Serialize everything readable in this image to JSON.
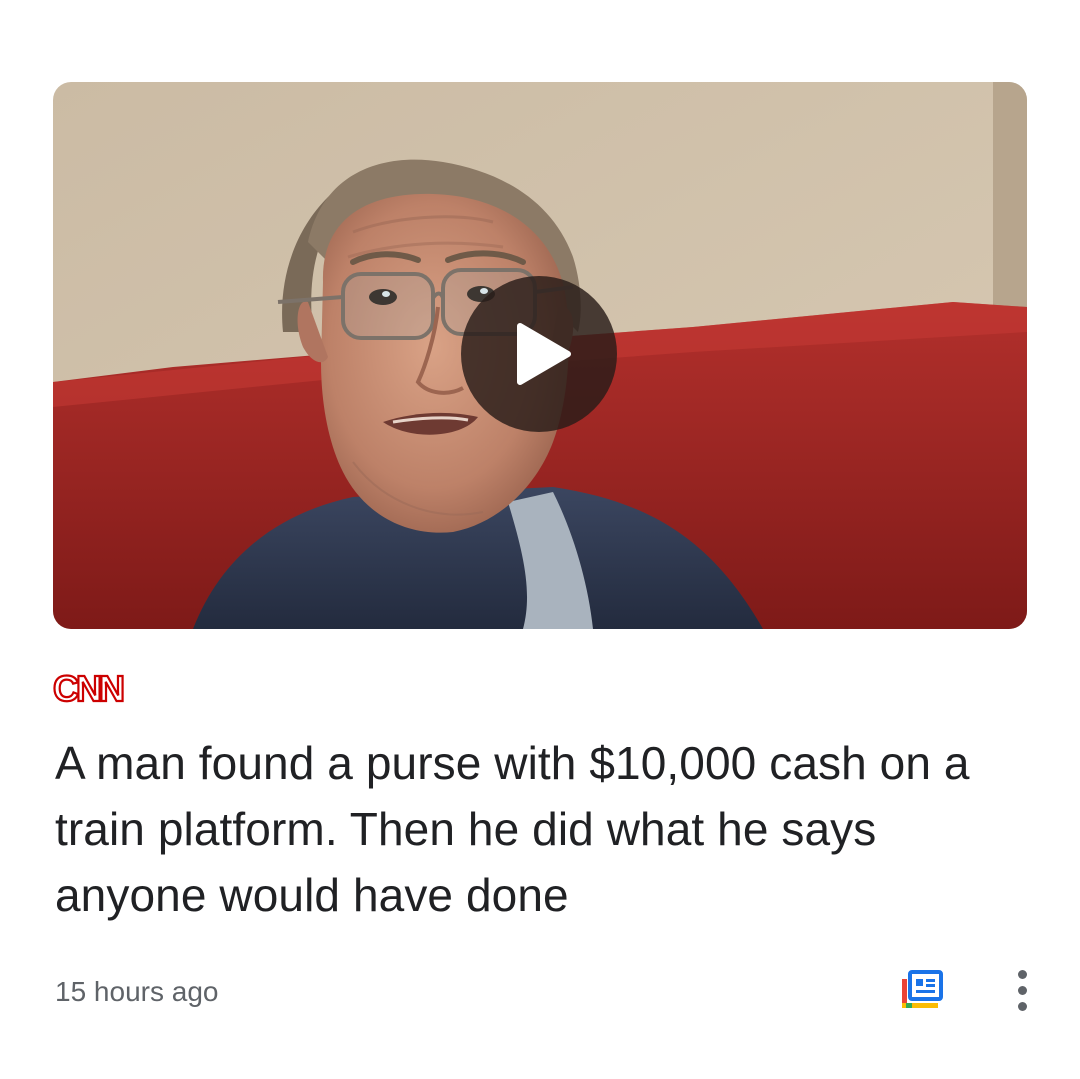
{
  "article": {
    "source": "CNN",
    "headline": "A man found a purse with $10,000 cash on a train platform. Then he did what he says anyone would have done",
    "timestamp": "15 hours ago",
    "media_type": "video"
  },
  "icons": {
    "play": "play-icon",
    "full_coverage": "full-coverage-icon",
    "more": "more-vert-icon"
  },
  "colors": {
    "source_brand": "#cc0000",
    "headline_text": "#202124",
    "secondary_text": "#5f6368",
    "full_coverage_blue": "#1a73e8",
    "full_coverage_red": "#ea4335",
    "full_coverage_yellow": "#fbbc04",
    "full_coverage_green": "#34a853"
  }
}
